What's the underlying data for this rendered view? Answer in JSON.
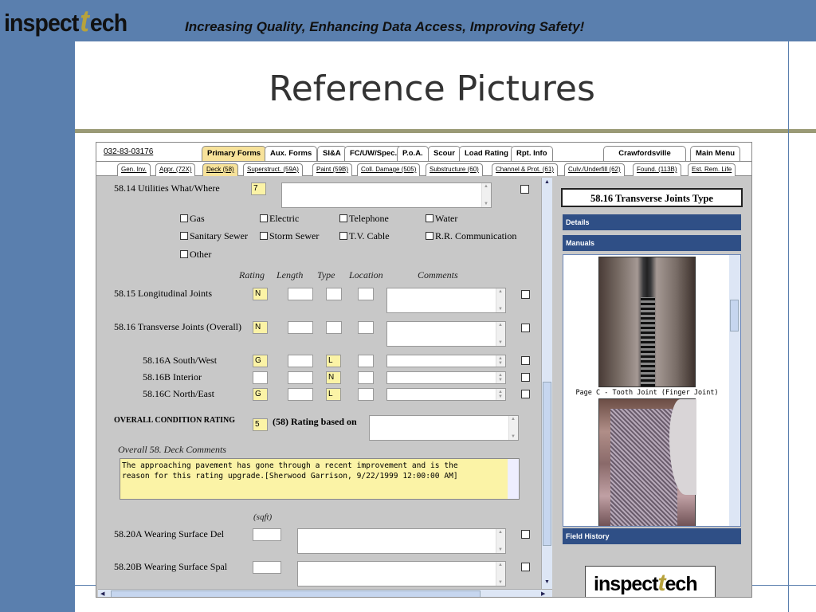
{
  "brand": {
    "logo_prefix": "inspect",
    "logo_t": "t",
    "logo_suffix": "ech",
    "tagline": "Increasing Quality, Enhancing Data Access, Improving Safety!"
  },
  "slide_title": "Reference Pictures",
  "app": {
    "record_id": "032-83-03176",
    "main_tabs": [
      "Primary Forms",
      "Aux. Forms",
      "SI&A",
      "FC/UW/Spec.",
      "P.o.A.",
      "Scour",
      "Load Rating",
      "Rpt. Info"
    ],
    "right_tabs": [
      "Crawfordsville",
      "Main Menu"
    ],
    "sub_tabs": [
      "Gen. Inv.",
      "Appr. (72X)",
      "Deck (58)",
      "Superstruct. (59A)",
      "Paint (59B)",
      "Coll. Damage (505)",
      "Substructure (60)",
      "Channel & Prot. (61)",
      "Culv./Underfill (62)",
      "Found. (113B)",
      "Est. Rem. Life"
    ],
    "form": {
      "utilities_label": "58.14 Utilities What/Where",
      "utilities_value": "7",
      "utility_options": [
        "Gas",
        "Electric",
        "Telephone",
        "Water",
        "Sanitary Sewer",
        "Storm Sewer",
        "T.V. Cable",
        "R.R. Communication",
        "Other"
      ],
      "columns": [
        "Rating",
        "Length",
        "Type",
        "Location",
        "Comments"
      ],
      "longitudinal_label": "58.15 Longitudinal Joints",
      "longitudinal_rating": "N",
      "transverse_label": "58.16 Transverse Joints (Overall)",
      "transverse_rating": "N",
      "sw_label": "58.16A South/West",
      "sw_rating": "G",
      "sw_type": "L",
      "interior_label": "58.16B Interior",
      "interior_rating": "",
      "interior_type": "N",
      "ne_label": "58.16C North/East",
      "ne_rating": "G",
      "ne_type": "L",
      "overall_label": "OVERALL CONDITION RATING",
      "overall_value": "5",
      "rating_based_label": "(58) Rating based on",
      "deck_comments_label": "Overall 58. Deck Comments",
      "deck_comments_line1": "The approaching pavement has gone through a recent improvement and is the",
      "deck_comments_line2": "reason for this rating upgrade.[Sherwood Garrison, 9/22/1999 12:00:00 AM]",
      "sqft_label": "(sqft)",
      "wearing_del_label": "58.20A Wearing Surface Del",
      "wearing_spal_label": "58.20B Wearing Surface Spal"
    },
    "side": {
      "title": "58.16 Transverse Joints Type",
      "details": "Details",
      "manuals": "Manuals",
      "caption": "Page C - Tooth Joint (Finger Joint)",
      "field_history": "Field History"
    }
  },
  "colors": {
    "accent_blue": "#5a7fae",
    "field_yellow": "#fbf3a6",
    "tab_active": "#f7e29a",
    "panel_bar": "#2f4f86"
  }
}
